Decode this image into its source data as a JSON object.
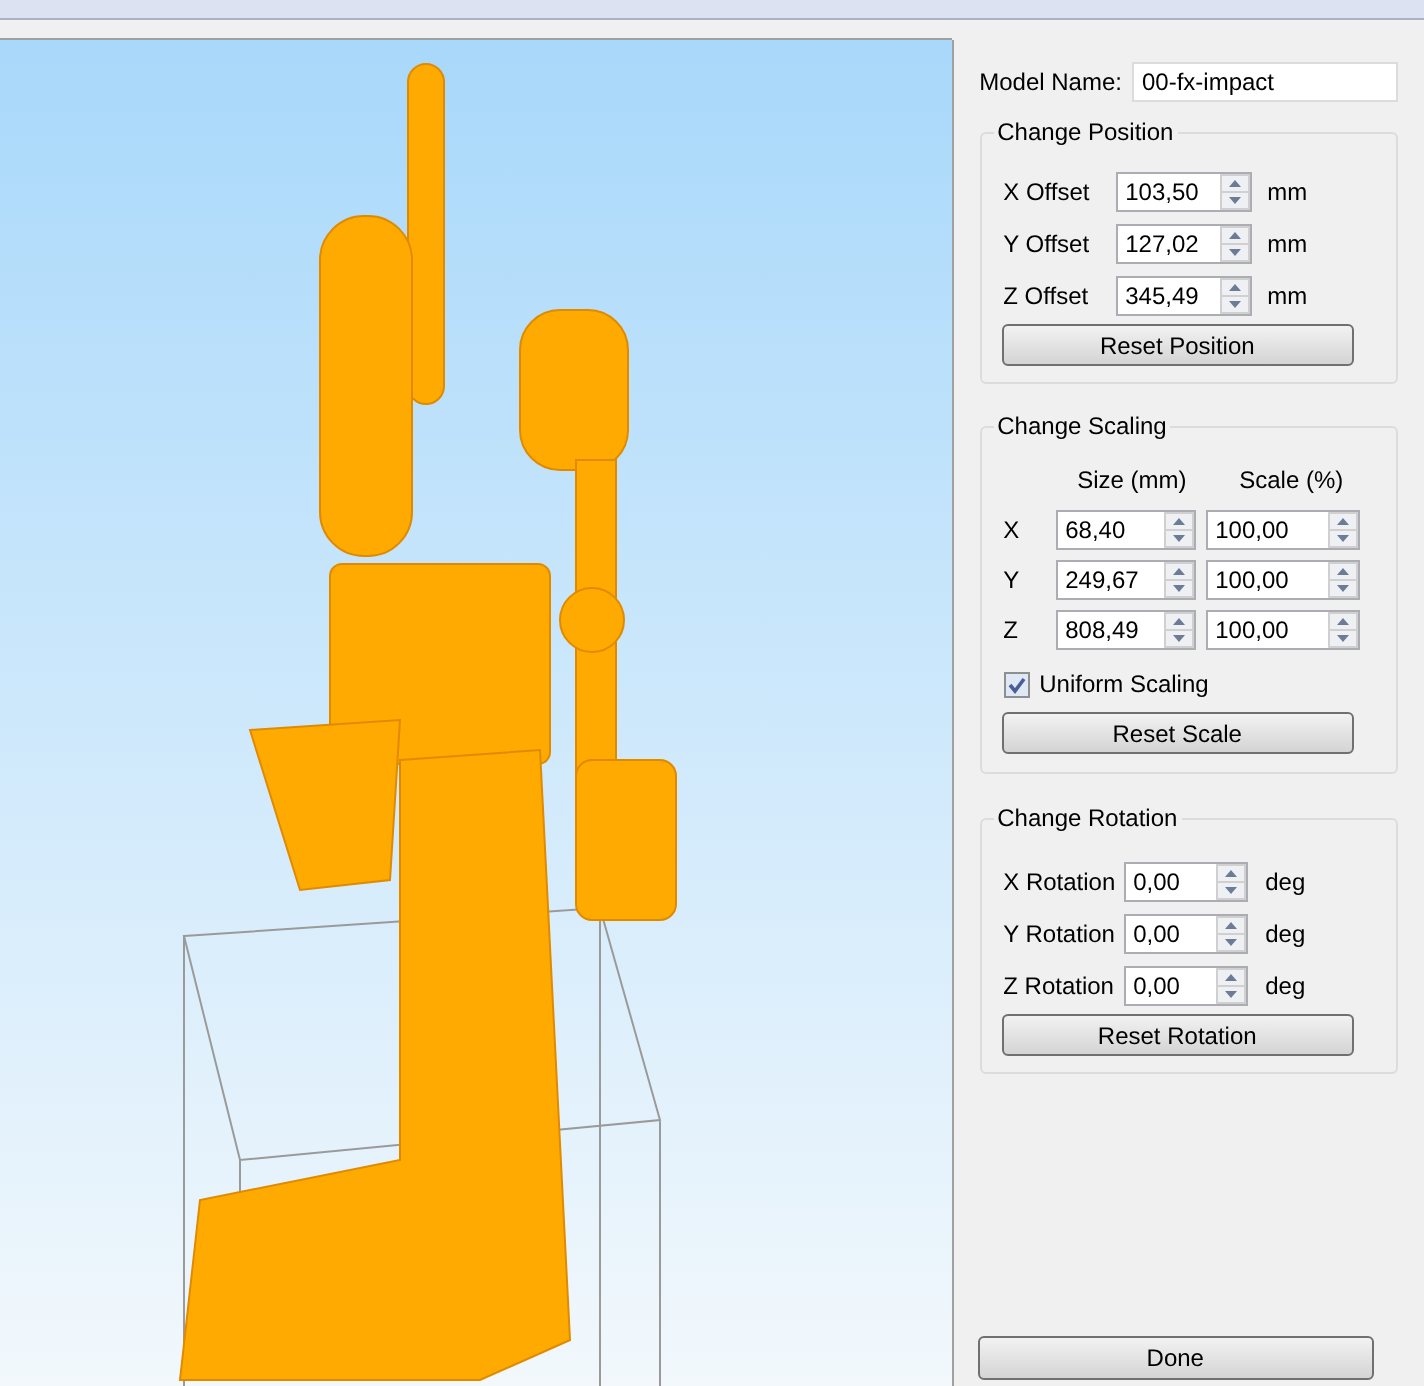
{
  "model_name": {
    "label": "Model Name:",
    "value": "00-fx-impact"
  },
  "position": {
    "title": "Change Position",
    "rows": [
      {
        "label": "X Offset",
        "value": "103,50",
        "unit": "mm"
      },
      {
        "label": "Y Offset",
        "value": "127,02",
        "unit": "mm"
      },
      {
        "label": "Z Offset",
        "value": "345,49",
        "unit": "mm"
      }
    ],
    "button": "Reset Position"
  },
  "scaling": {
    "title": "Change Scaling",
    "columns": [
      "Size (mm)",
      "Scale (%)"
    ],
    "rows": [
      {
        "axis": "X",
        "size": "68,40",
        "scale": "100,00"
      },
      {
        "axis": "Y",
        "size": "249,67",
        "scale": "100,00"
      },
      {
        "axis": "Z",
        "size": "808,49",
        "scale": "100,00"
      }
    ],
    "uniform": {
      "label": "Uniform Scaling",
      "checked": true
    },
    "button": "Reset Scale"
  },
  "rotation": {
    "title": "Change Rotation",
    "rows": [
      {
        "label": "X Rotation",
        "value": "0,00",
        "unit": "deg"
      },
      {
        "label": "Y Rotation",
        "value": "0,00",
        "unit": "deg"
      },
      {
        "label": "Z Rotation",
        "value": "0,00",
        "unit": "deg"
      }
    ],
    "button": "Reset Rotation"
  },
  "done_button": "Done"
}
